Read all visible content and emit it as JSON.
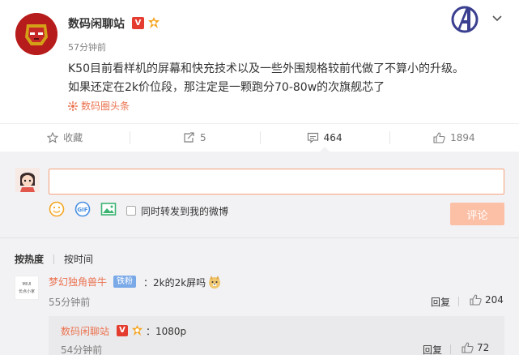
{
  "post": {
    "author": "数码闲聊站",
    "verified_label": "V",
    "time": "57分钟前",
    "text_line1": "K50目前看样机的屏幕和快充技术以及一些外围规格较前代做了不算小的升级。",
    "text_line2": "如果还定在2k价位段，那注定是一颗跑分70-80w的次旗舰芯了",
    "topic": "数码圈头条"
  },
  "actions": {
    "favorite_label": "收藏",
    "repost_count": "5",
    "comment_count": "464",
    "like_count": "1894"
  },
  "composer": {
    "forward_label": "同时转发到我的微博",
    "submit_label": "评论",
    "gif_label": "GIF"
  },
  "sort": {
    "hot": "按热度",
    "time": "按时间"
  },
  "comments": [
    {
      "logo_text_1": "MIUI",
      "logo_text_2": "长点小家",
      "user": "梦幻独角兽牛",
      "tag": "铁粉",
      "text": "：2k的2k屏吗",
      "time": "55分钟前",
      "reply_label": "回复",
      "likes": "204"
    }
  ],
  "subreply": {
    "user": "数码闲聊站",
    "verified_label": "V",
    "text": "：1080p",
    "time": "54分钟前",
    "reply_label": "回复",
    "likes": "72"
  },
  "colors": {
    "accent": "#eb7350",
    "submit_disabled": "#fcc0a6",
    "panel_bg": "#f2f2f5",
    "fans_tag": "#7aa9e8",
    "verified_red": "#e43c2f"
  }
}
